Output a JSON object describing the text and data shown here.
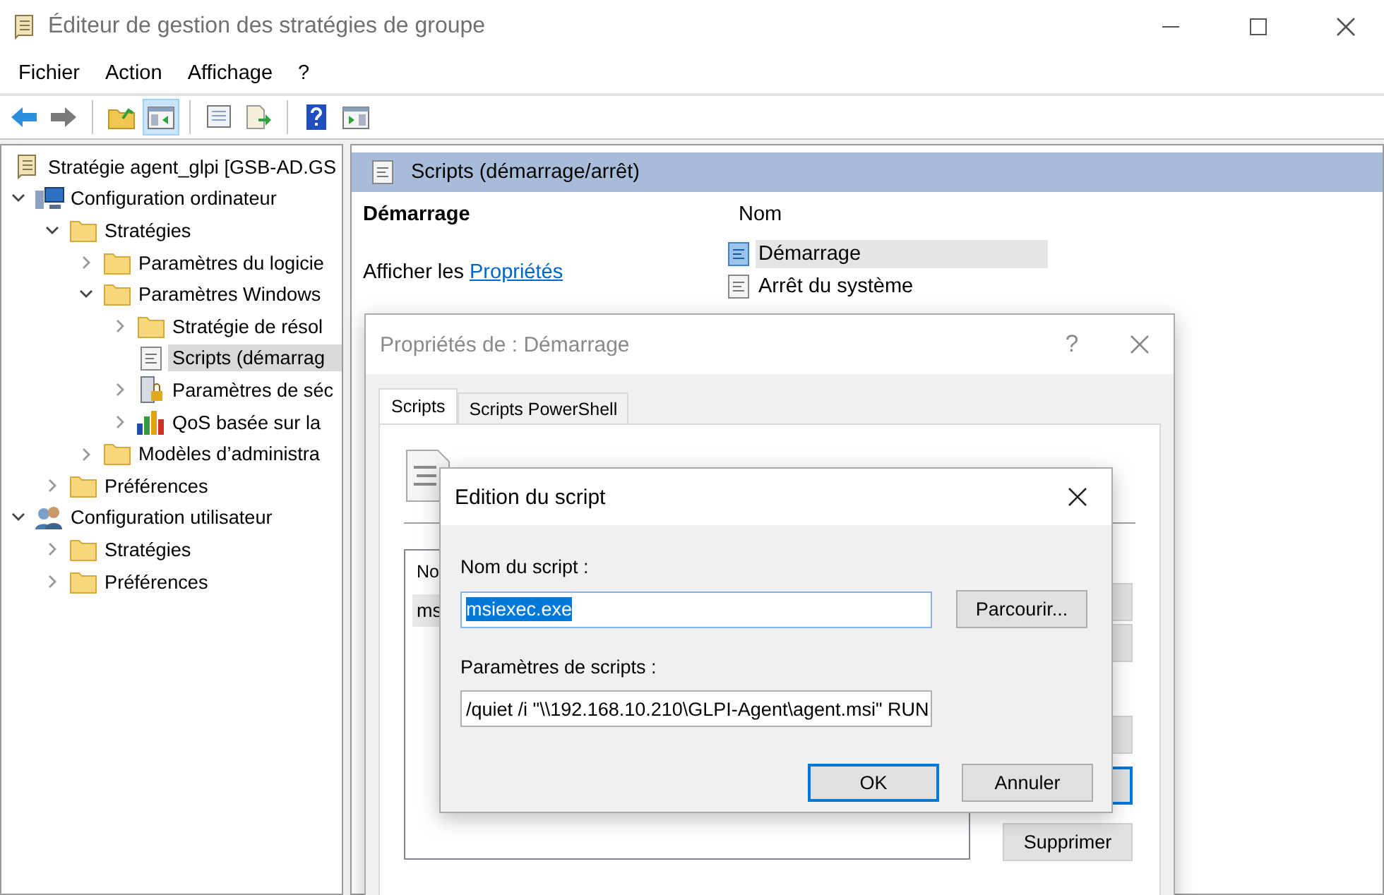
{
  "window": {
    "title": "Éditeur de gestion des stratégies de groupe"
  },
  "menu": [
    {
      "label": "Fichier"
    },
    {
      "label": "Action"
    },
    {
      "label": "Affichage"
    },
    {
      "label": "?"
    }
  ],
  "toolbar": [
    {
      "kind": "back",
      "pressed": false
    },
    {
      "kind": "forward",
      "pressed": false
    },
    {
      "kind": "separator"
    },
    {
      "kind": "up",
      "pressed": false
    },
    {
      "kind": "tree",
      "pressed": true
    },
    {
      "kind": "separator"
    },
    {
      "kind": "properties",
      "pressed": false
    },
    {
      "kind": "export",
      "pressed": false
    },
    {
      "kind": "separator"
    },
    {
      "kind": "help",
      "pressed": false
    },
    {
      "kind": "pane",
      "pressed": false
    }
  ],
  "tree": {
    "label": "Stratégie agent_glpi [GSB-AD.GS",
    "kind": "policy",
    "selected": false,
    "children": [
      {
        "label": "Configuration ordinateur",
        "kind": "computer",
        "expandable": true,
        "expanded": true,
        "selected": false,
        "children": [
          {
            "label": "Stratégies",
            "kind": "folder",
            "expandable": true,
            "expanded": true,
            "selected": false,
            "children": [
              {
                "label": "Paramètres du logicie",
                "kind": "folder",
                "expandable": true,
                "expanded": false,
                "selected": false
              },
              {
                "label": "Paramètres Windows",
                "kind": "folder",
                "expandable": true,
                "expanded": true,
                "selected": false,
                "children": [
                  {
                    "label": "Stratégie de résol",
                    "kind": "folder",
                    "expandable": true,
                    "expanded": false,
                    "selected": false
                  },
                  {
                    "label": "Scripts (démarrag",
                    "kind": "script",
                    "expandable": false,
                    "expanded": false,
                    "selected": true
                  },
                  {
                    "label": "Paramètres de séc",
                    "kind": "lock",
                    "expandable": true,
                    "expanded": false,
                    "selected": false
                  },
                  {
                    "label": "QoS basée sur la",
                    "kind": "chart",
                    "expandable": true,
                    "expanded": false,
                    "selected": false
                  }
                ]
              },
              {
                "label": "Modèles d’administra",
                "kind": "folder",
                "expandable": true,
                "expanded": false,
                "selected": false
              }
            ]
          },
          {
            "label": "Préférences",
            "kind": "folder",
            "expandable": true,
            "expanded": false,
            "selected": false
          }
        ]
      },
      {
        "label": "Configuration utilisateur",
        "kind": "user",
        "expandable": true,
        "expanded": true,
        "selected": false,
        "children": [
          {
            "label": "Stratégies",
            "kind": "folder",
            "expandable": true,
            "expanded": false,
            "selected": false
          },
          {
            "label": "Préférences",
            "kind": "folder",
            "expandable": true,
            "expanded": false,
            "selected": false
          }
        ]
      }
    ]
  },
  "details": {
    "header": "Scripts (démarrage/arrêt)",
    "heading": "Démarrage",
    "text": "Afficher les ",
    "link": "Propriétés",
    "list": {
      "column": "Nom",
      "items": [
        {
          "label": "Démarrage",
          "selected": true
        },
        {
          "label": "Arrêt du système",
          "selected": false
        }
      ]
    }
  },
  "properties_dialog": {
    "title": "Propriétés de : Démarrage",
    "help": "?",
    "tabs": [
      {
        "label": "Scripts",
        "selected": true
      },
      {
        "label": "Scripts PowerShell",
        "selected": false
      }
    ],
    "list": {
      "column": "No",
      "rows": [
        {
          "label": "ms",
          "selected": true
        }
      ]
    },
    "side_buttons": [
      {
        "default": false
      },
      {
        "default": false
      },
      {
        "default": false
      },
      {
        "default": true
      },
      {
        "label": "Supprimer",
        "default": false
      }
    ]
  },
  "edit_dialog": {
    "title": "Edition du script",
    "fields": [
      {
        "label": "Nom du script :",
        "value": "msiexec.exe",
        "selected": true,
        "button": "Parcourir..."
      },
      {
        "label": "Paramètres de scripts :",
        "value": "/quiet /i \"\\\\192.168.10.210\\GLPI-Agent\\agent.msi\" RUN",
        "selected": false
      }
    ],
    "buttons": [
      {
        "label": "OK",
        "default": true
      },
      {
        "label": "Annuler",
        "default": false
      }
    ]
  }
}
